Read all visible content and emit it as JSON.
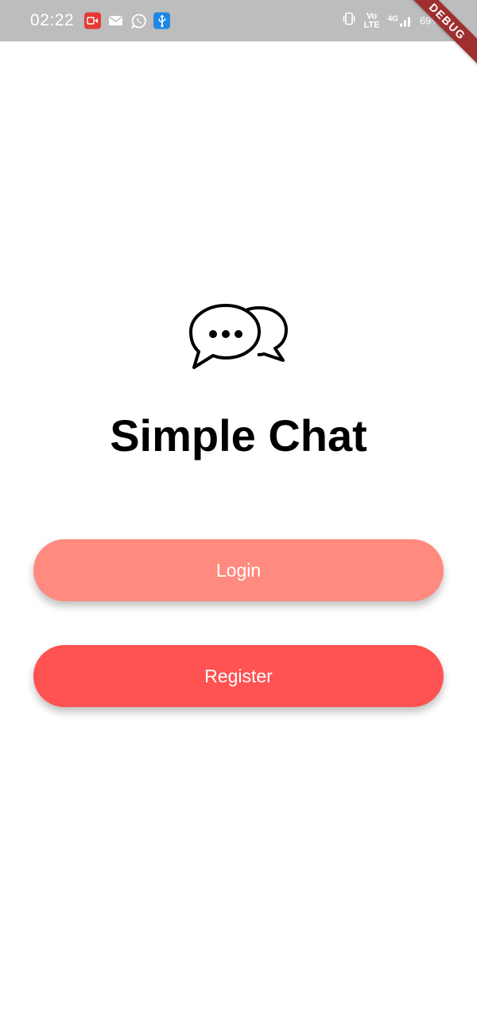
{
  "status_bar": {
    "time": "02:22",
    "notification_icons": [
      "screen-record-icon",
      "gmail-icon",
      "whatsapp-icon",
      "usb-icon"
    ],
    "system_icons": [
      "vibrate-icon",
      "volte-icon",
      "4g-signal-icon"
    ],
    "volte_label_top": "Vo",
    "volte_label_bottom": "LTE",
    "network_label": "4G",
    "battery": "69%"
  },
  "debug_banner": "DEBUG",
  "app": {
    "logo_icon": "chat-bubbles-icon",
    "title": "Simple Chat"
  },
  "buttons": {
    "login": "Login",
    "register": "Register"
  },
  "colors": {
    "status_bar": "#bdbdbd",
    "login_button": "#ff8a80",
    "register_button": "#ff5252",
    "debug_ribbon": "#9e3030"
  }
}
